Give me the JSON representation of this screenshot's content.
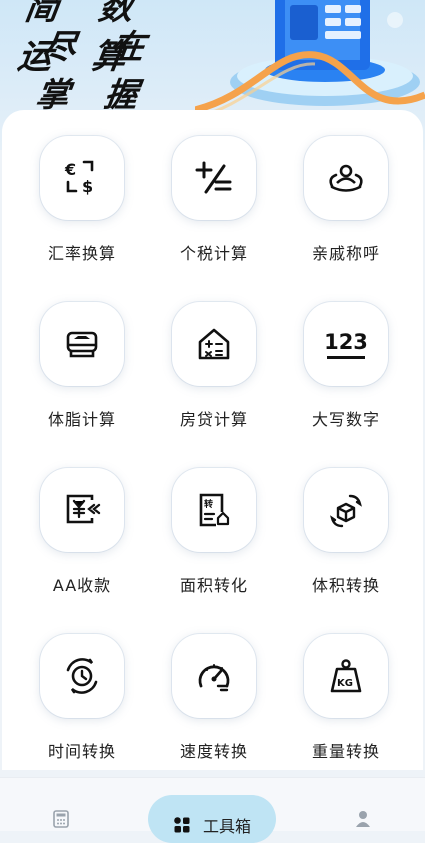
{
  "banner": {
    "slogan_line1": "简 数 运 算",
    "slogan_line2": "尽 在 掌 握"
  },
  "tools": [
    {
      "label": "汇率换算",
      "icon": "currency-exchange-icon"
    },
    {
      "label": "个税计算",
      "icon": "plus-minus-icon"
    },
    {
      "label": "亲戚称呼",
      "icon": "relatives-icon"
    },
    {
      "label": "体脂计算",
      "icon": "body-fat-scale-icon"
    },
    {
      "label": "房贷计算",
      "icon": "house-calc-icon"
    },
    {
      "label": "大写数字",
      "icon": "numbers-123-icon",
      "text": "123"
    },
    {
      "label": "AA收款",
      "icon": "yuan-receipt-icon"
    },
    {
      "label": "面积转化",
      "icon": "area-convert-icon"
    },
    {
      "label": "体积转换",
      "icon": "volume-convert-icon"
    },
    {
      "label": "时间转换",
      "icon": "time-convert-icon"
    },
    {
      "label": "速度转换",
      "icon": "speedometer-icon"
    },
    {
      "label": "重量转换",
      "icon": "kg-weight-icon",
      "text": "KG"
    }
  ],
  "tabbar": {
    "active_label": "工具箱",
    "left_icon": "calculator-icon",
    "active_icon": "toolbox-grid-icon",
    "right_icon": "user-icon"
  },
  "colors": {
    "accent": "#bfe4f4",
    "banner_blue": "#1e6ff0",
    "orange": "#f5a24b"
  }
}
